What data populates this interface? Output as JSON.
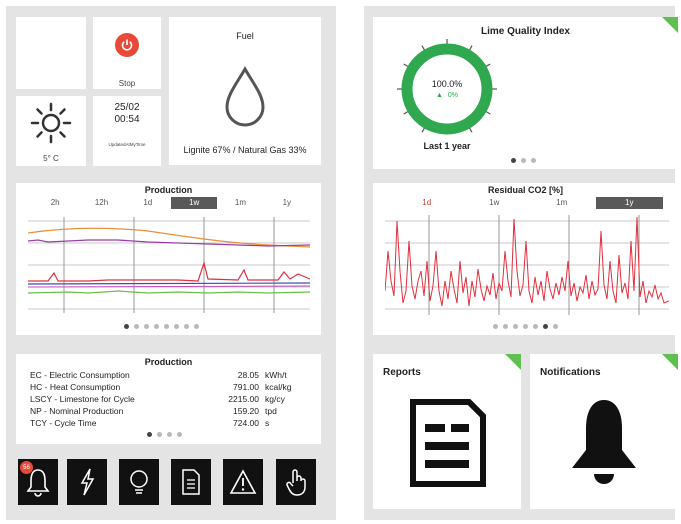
{
  "left": {
    "stop": {
      "label": "Stop"
    },
    "fuel": {
      "title": "Fuel",
      "mix": "Lignite 67% / Natural Gas 33%"
    },
    "weather": {
      "temperature": "5° C"
    },
    "datetime": {
      "date": "25/02",
      "time": "00:54",
      "note": "UpdatedAtMyTime"
    },
    "production_chart": {
      "title": "Production",
      "ranges": [
        "2h",
        "12h",
        "1d",
        "1w",
        "1m",
        "1y"
      ],
      "active_range": "1w",
      "dots": 8,
      "active_dot": 0
    },
    "production_table": {
      "title": "Production",
      "rows": [
        {
          "label": "EC - Electric Consumption",
          "value": "28.05",
          "unit": "kWh/t"
        },
        {
          "label": "HC - Heat Consumption",
          "value": "791.00",
          "unit": "kcal/kg"
        },
        {
          "label": "LSCY - Limestone for Cycle",
          "value": "2215.00",
          "unit": "kg/cy"
        },
        {
          "label": "NP - Nominal Production",
          "value": "159.20",
          "unit": "tpd"
        },
        {
          "label": "TCY - Cycle Time",
          "value": "724.00",
          "unit": "s"
        }
      ],
      "dots": 4,
      "active_dot": 0
    },
    "toolbar": {
      "alarm_badge": "56",
      "icons": [
        "bell-icon",
        "lightning-icon",
        "bulb-icon",
        "document-icon",
        "warning-icon",
        "touch-icon"
      ]
    }
  },
  "right": {
    "lime_quality": {
      "title": "Lime Quality Index",
      "value": "100.0%",
      "change": "0%",
      "period": "Last 1 year",
      "gauge_fraction": 1.0,
      "dots": 3,
      "active_dot": 0
    },
    "residual": {
      "title": "Residual CO2 [%]",
      "ranges": [
        "1d",
        "1w",
        "1m",
        "1y"
      ],
      "active_range": "1y",
      "dots": 7,
      "active_dot": 5
    },
    "reports": {
      "title": "Reports"
    },
    "notifications": {
      "title": "Notifications"
    }
  },
  "colors": {
    "stop_red": "#e84a3a",
    "gauge_green": "#2fa84f",
    "accent_green": "#5fbf50",
    "series_red": "#e0303f"
  }
}
